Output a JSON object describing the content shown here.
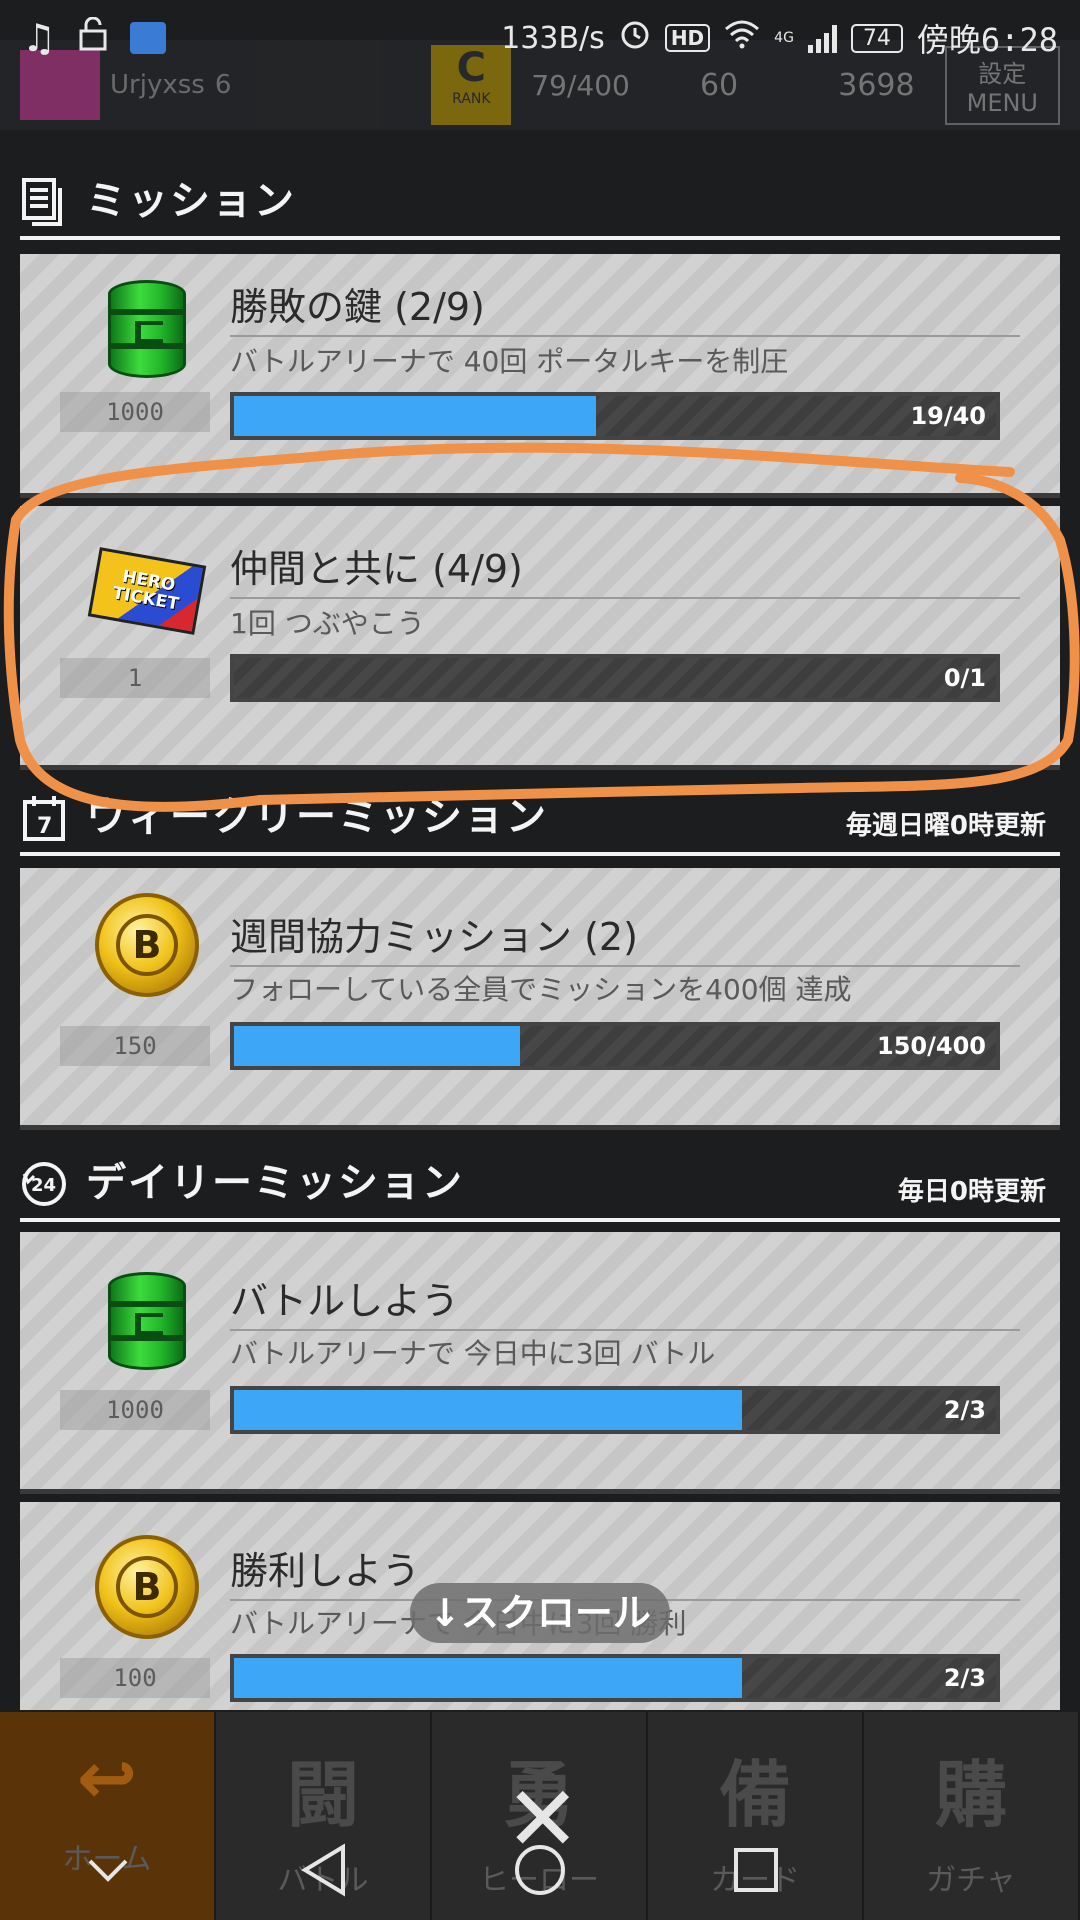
{
  "status_bar": {
    "net_speed": "133B/s",
    "hd": "HD",
    "network": "4G",
    "battery": "74",
    "time": "傍晚6:28"
  },
  "game_header": {
    "player_name": "Urjyxss",
    "level": "6",
    "rank": "C",
    "rank_label": "RANK",
    "exp": "79/400",
    "coins_top": "60",
    "coins": "3698",
    "menu_top": "設定",
    "menu_label": "MENU"
  },
  "sections": {
    "missions": {
      "title": "ミッション"
    },
    "weekly": {
      "title": "ウィークリーミッション",
      "refresh": "毎週日曜0時更新"
    },
    "daily": {
      "title": "デイリーミッション",
      "refresh": "毎日0時更新"
    }
  },
  "cards": [
    {
      "icon": "green-barrel-icon",
      "reward": "1000",
      "title": "勝敗の鍵 (2/9)",
      "desc": "バトルアリーナで 40回 ポータルキーを制圧",
      "progress_text": "19/40",
      "progress": 0.475
    },
    {
      "icon": "hero-ticket-icon",
      "reward": "1",
      "title": "仲間と共に (4/9)",
      "desc": "1回 つぶやこう",
      "progress_text": "0/1",
      "progress": 0
    },
    {
      "icon": "gold-coin-icon",
      "reward": "150",
      "title": "週間協力ミッション (2)",
      "desc": "フォローしている全員でミッションを400個 達成",
      "progress_text": "150/400",
      "progress": 0.375
    },
    {
      "icon": "green-barrel-icon",
      "reward": "1000",
      "title": "バトルしよう",
      "desc": "バトルアリーナで 今日中に3回 バトル",
      "progress_text": "2/3",
      "progress": 0.667
    },
    {
      "icon": "gold-coin-icon",
      "reward": "100",
      "title": "勝利しよう",
      "desc": "バトルアリーナで 今日中に3回 勝利",
      "progress_text": "2/3",
      "progress": 0.667
    }
  ],
  "icons": {
    "ticket_text": "HERO TICKET",
    "coin_letter": "B"
  },
  "scroll_hint": "↓スクロール",
  "bottom_nav": [
    {
      "glyph": "↩",
      "label": "ホーム"
    },
    {
      "glyph": "闘",
      "label": "バトル"
    },
    {
      "glyph": "勇",
      "label": "ヒーロー"
    },
    {
      "glyph": "備",
      "label": "カード"
    },
    {
      "glyph": "購",
      "label": "ガチャ"
    }
  ],
  "close_glyph": "✕",
  "colors": {
    "progress_fill": "#3ea6f7",
    "annotation_ring": "#f0914a",
    "background": "#1c1d1f"
  }
}
